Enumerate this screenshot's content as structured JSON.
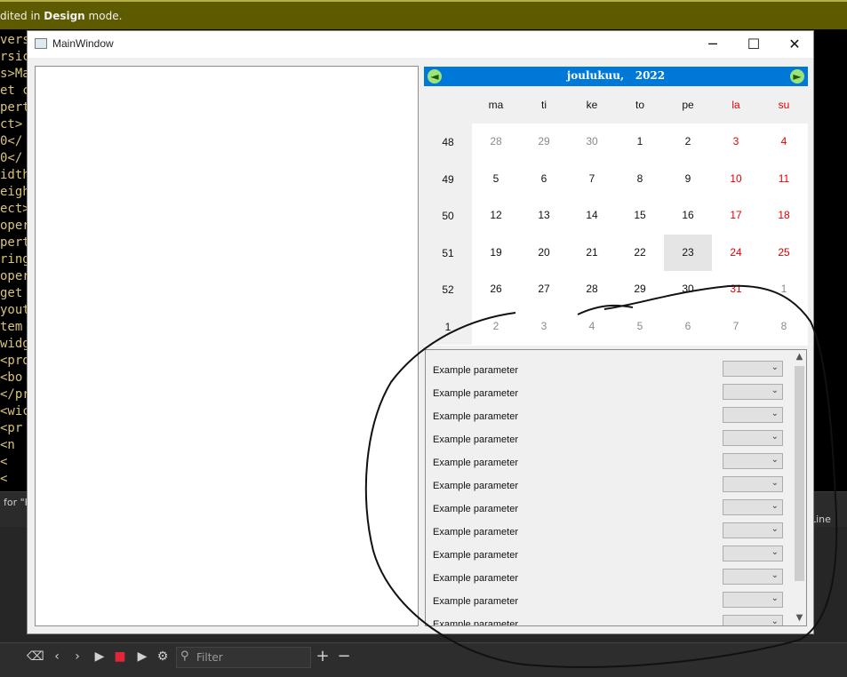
{
  "designer_banner": {
    "prefix": "dited in ",
    "mode": "Design",
    "suffix": " mode."
  },
  "code_lines": [
    "vers",
    "rsic",
    "s>Ma",
    "et c",
    "pert",
    "ct>",
    "0</",
    "0</",
    "idth",
    "eigh",
    "ect>",
    "oper",
    "pert",
    "ring",
    "oper",
    "get",
    "yout",
    "tem",
    "widg",
    "<pro",
    "<bo",
    "</pr",
    "<wic",
    "<pr",
    "<n",
    "<",
    "<"
  ],
  "find_label": "for \"K",
  "line_label": "Line",
  "filter": {
    "placeholder": "Filter"
  },
  "main_window": {
    "title": "MainWindow",
    "min_glyph": "─",
    "max_glyph": "☐",
    "close_glyph": "✕"
  },
  "calendar": {
    "month": "joulukuu,",
    "year": "2022",
    "prev_icon": "arrow-left-icon",
    "next_icon": "arrow-right-icon",
    "weekdays": [
      "ma",
      "ti",
      "ke",
      "to",
      "pe",
      "la",
      "su"
    ],
    "weeks": [
      {
        "num": "48",
        "days": [
          "28",
          "29",
          "30",
          "1",
          "2",
          "3",
          "4"
        ]
      },
      {
        "num": "49",
        "days": [
          "5",
          "6",
          "7",
          "8",
          "9",
          "10",
          "11"
        ]
      },
      {
        "num": "50",
        "days": [
          "12",
          "13",
          "14",
          "15",
          "16",
          "17",
          "18"
        ]
      },
      {
        "num": "51",
        "days": [
          "19",
          "20",
          "21",
          "22",
          "23",
          "24",
          "25"
        ]
      },
      {
        "num": "52",
        "days": [
          "26",
          "27",
          "28",
          "29",
          "30",
          "31",
          "1"
        ]
      },
      {
        "num": "1",
        "days": [
          "2",
          "3",
          "4",
          "5",
          "6",
          "7",
          "8"
        ]
      }
    ],
    "selected": "23"
  },
  "parameters": {
    "label": "Example parameter",
    "count": 12,
    "combo_value": ""
  },
  "colors": {
    "accent": "#0078d7",
    "weekend": "#e00000",
    "banner": "#5d5a00"
  }
}
